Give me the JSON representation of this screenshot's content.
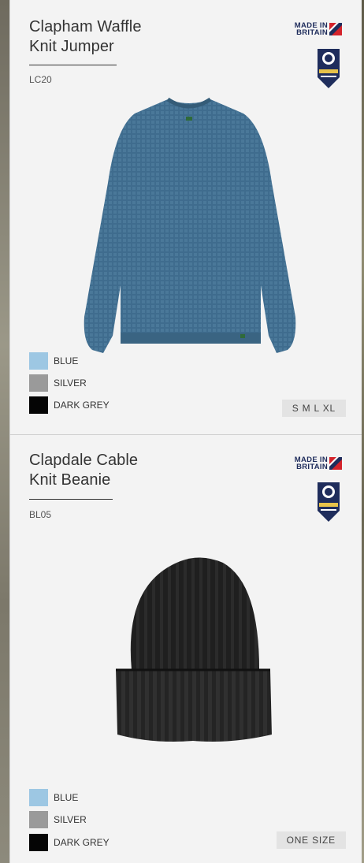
{
  "products": [
    {
      "title_line1": "Clapham Waffle",
      "title_line2": "Knit Jumper",
      "code": "LC20",
      "made_in_line1": "MADE IN",
      "made_in_line2": "BRITAIN",
      "image_icon": "knit-jumper",
      "image_color": "#3f6c8e",
      "colours": [
        {
          "label": "BLUE",
          "hex": "#9dc7e3"
        },
        {
          "label": "SILVER",
          "hex": "#9a9a9a"
        },
        {
          "label": "DARK GREY",
          "hex": "#050505"
        }
      ],
      "sizes": "S M L XL"
    },
    {
      "title_line1": "Clapdale Cable",
      "title_line2": "Knit Beanie",
      "code": "BL05",
      "made_in_line1": "MADE IN",
      "made_in_line2": "BRITAIN",
      "image_icon": "knit-beanie",
      "image_color": "#1e1e1e",
      "colours": [
        {
          "label": "BLUE",
          "hex": "#9dc7e3"
        },
        {
          "label": "SILVER",
          "hex": "#9a9a9a"
        },
        {
          "label": "DARK GREY",
          "hex": "#050505"
        }
      ],
      "sizes": "ONE SIZE"
    }
  ],
  "theme": {
    "brand_navy": "#1f2d5c",
    "union_red": "#d4232b",
    "card_bg": "#f3f3f3"
  }
}
